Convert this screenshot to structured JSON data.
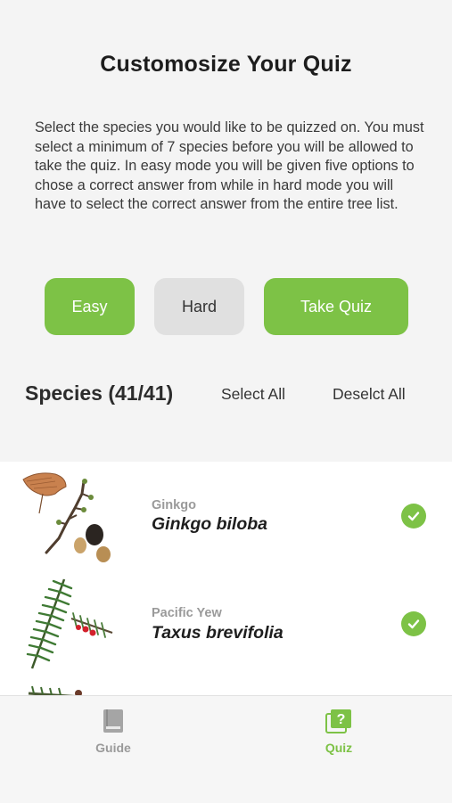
{
  "header": {
    "title": "Customosize Your Quiz",
    "description": "Select the species you would like to be quizzed on. You must select a minimum of 7 species before you will be allowed to take the quiz.  In easy mode you will be given five options to chose a correct answer from while in hard mode you will have to select the correct answer from the entire tree list."
  },
  "mode_buttons": {
    "easy": "Easy",
    "hard": "Hard",
    "take_quiz": "Take Quiz",
    "selected_mode": "Easy"
  },
  "species_section": {
    "title": "Species (41/41)",
    "select_all": "Select All",
    "deselect_all": "Deselct All"
  },
  "species": [
    {
      "common_name": "Ginkgo",
      "scientific_name": "Ginkgo biloba",
      "selected": true,
      "icon": "ginkgo-branch"
    },
    {
      "common_name": "Pacific Yew",
      "scientific_name": "Taxus brevifolia",
      "selected": true,
      "icon": "yew-branch"
    }
  ],
  "tabbar": {
    "tabs": [
      {
        "label": "Guide",
        "icon": "book-icon",
        "active": false
      },
      {
        "label": "Quiz",
        "icon": "quiz-icon",
        "active": true
      }
    ]
  },
  "colors": {
    "accent": "#7dc246",
    "background": "#f4f4f4",
    "inactive_button": "#e0e0e0"
  }
}
